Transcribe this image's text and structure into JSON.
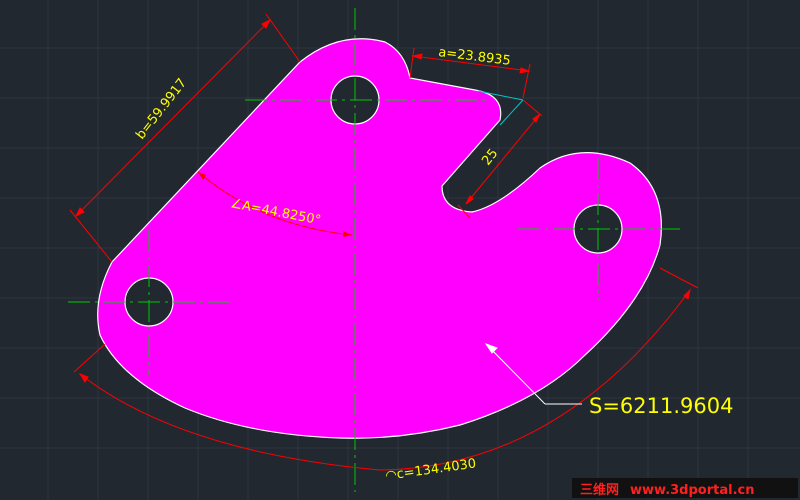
{
  "colors": {
    "background": "#212830",
    "grid": "#2d353f",
    "part_fill": "#ff00ff",
    "part_edge": "#ffffff",
    "hole_fill": "#212830",
    "center_lines": "#00c800",
    "dimension_lines": "#ff0000",
    "dimension_text": "#ffff00",
    "helper_lines": "#00c8c8",
    "leader": "#ffffff",
    "area_text": "#ffff00",
    "watermark_cn": "#ff2020",
    "watermark_url": "#ff2020"
  },
  "dimensions": {
    "b_label": "b=59.9917",
    "a_label": "a=23.8935",
    "slot_label": "25",
    "angle_label": "∠A=44.8250°",
    "arc_label": "◠c=134.4030"
  },
  "area_label": "S=6211.9604",
  "watermark": {
    "chinese": "三维网",
    "url": "www.3dportal.cn"
  }
}
